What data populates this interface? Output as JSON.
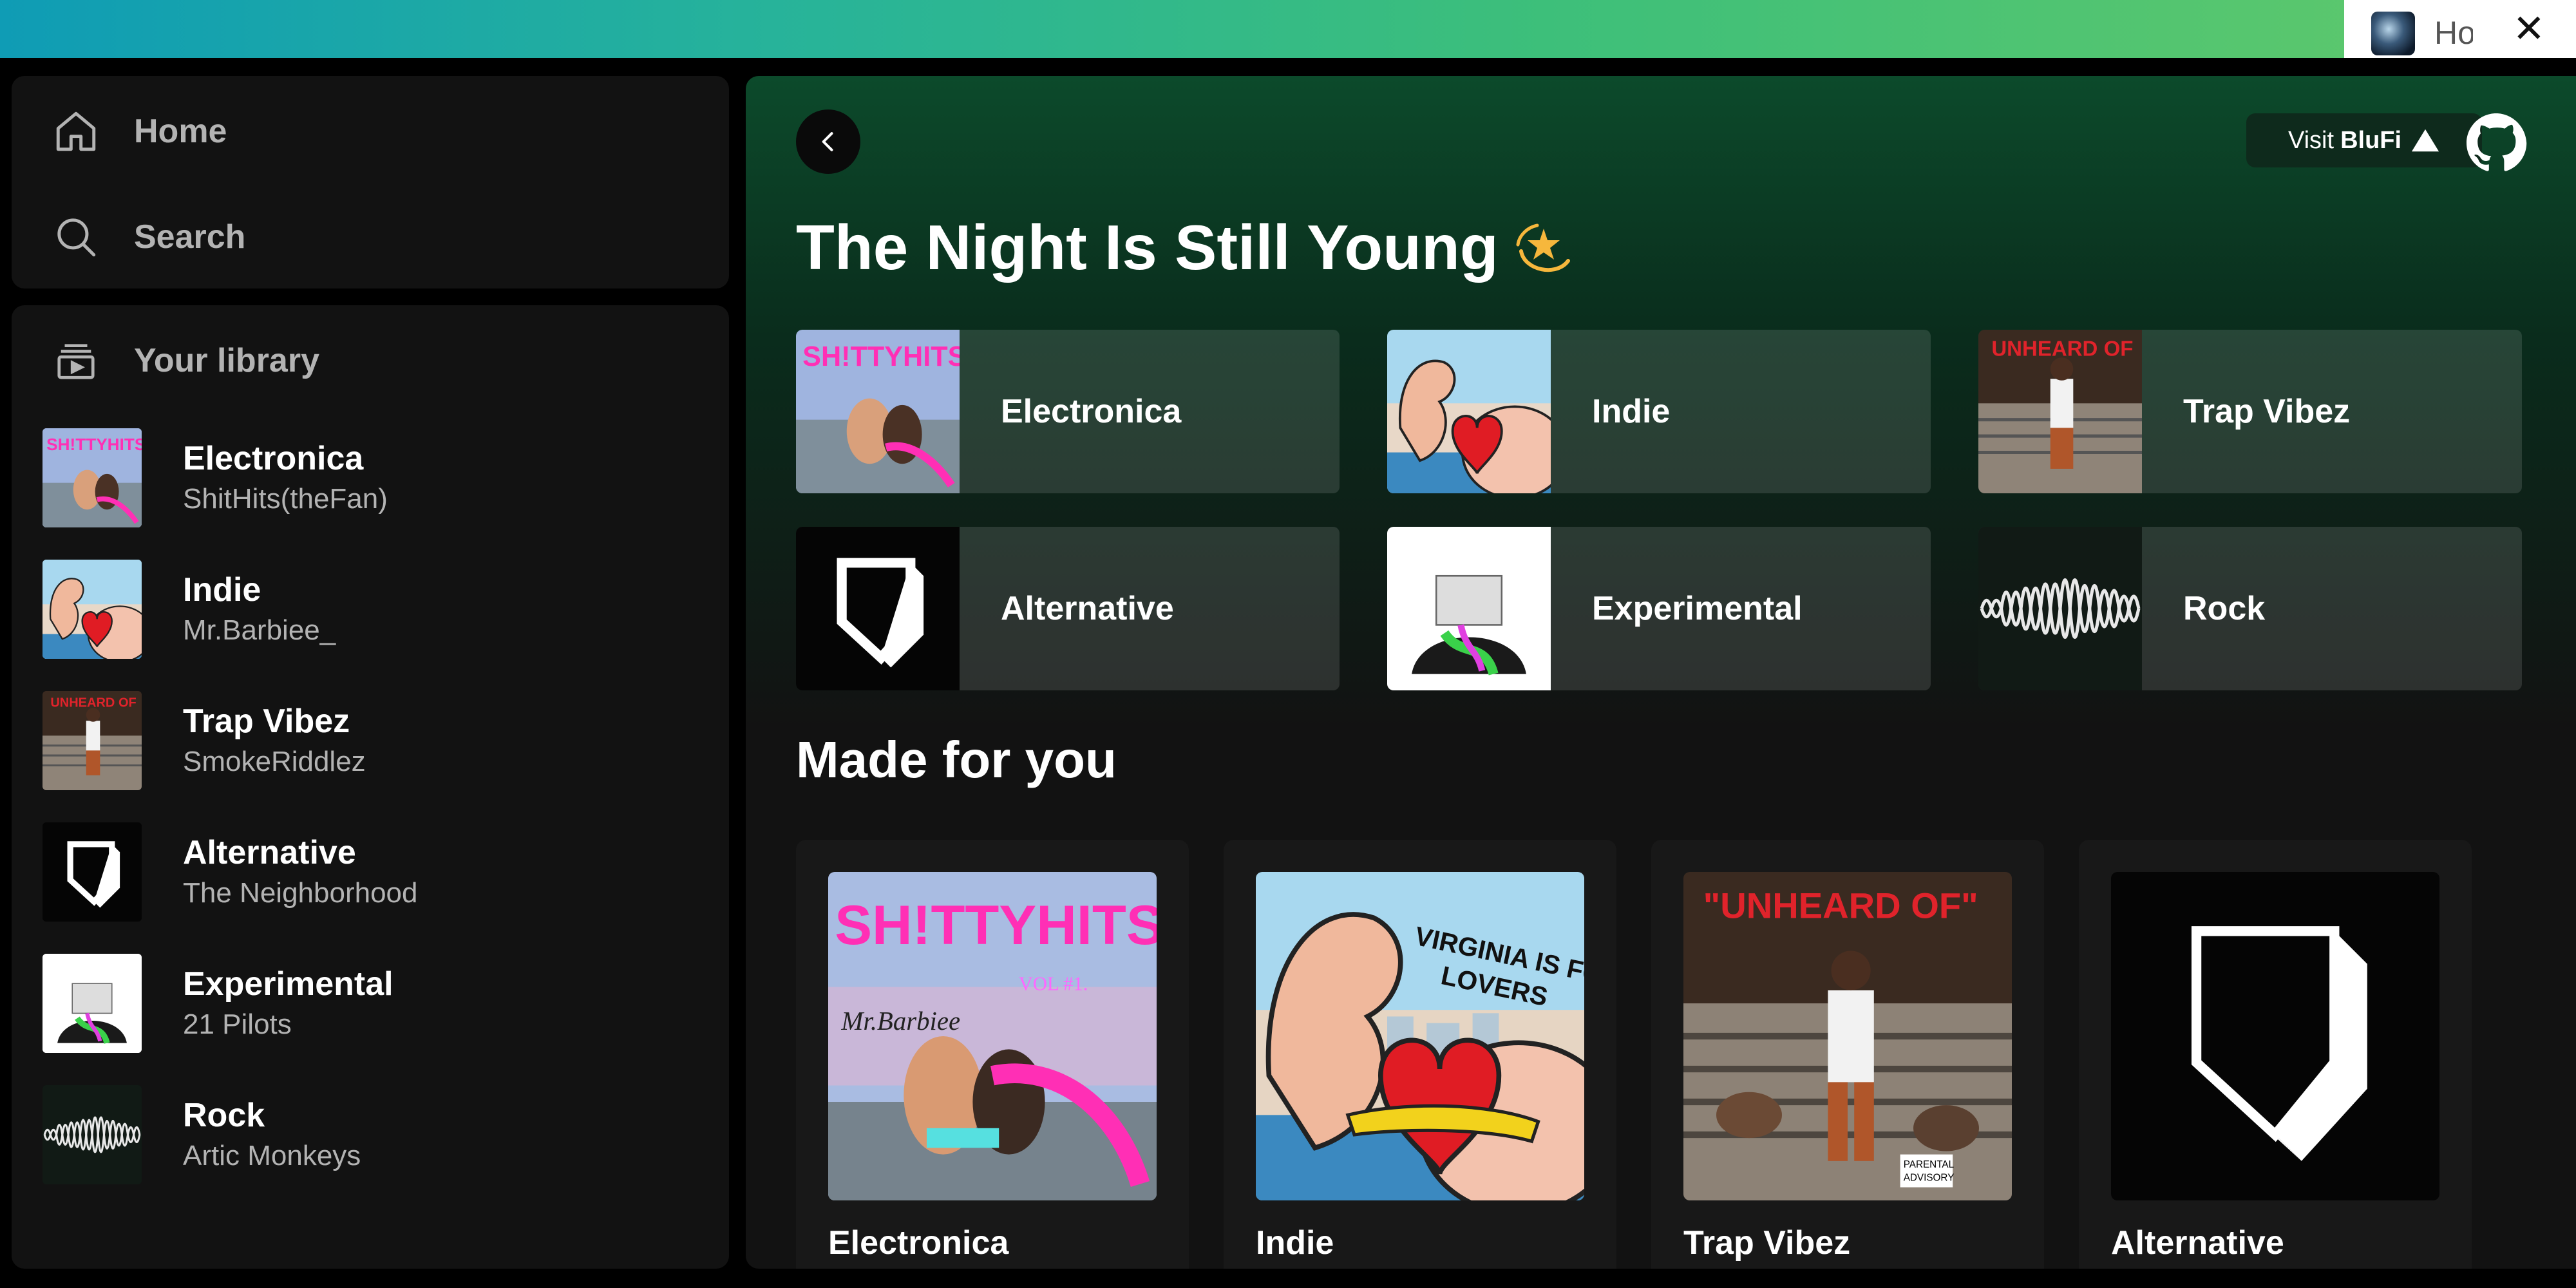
{
  "browser_tab": {
    "title": "Ho",
    "close_glyph": "✕",
    "icon": "avatar-icon"
  },
  "nav": {
    "home": {
      "label": "Home",
      "icon": "home-icon"
    },
    "search": {
      "label": "Search",
      "icon": "search-icon"
    }
  },
  "library": {
    "title": "Your library",
    "icon": "library-icon",
    "items": [
      {
        "title": "Electronica",
        "artist": "ShitHits(theFan)"
      },
      {
        "title": "Indie",
        "artist": "Mr.Barbiee_"
      },
      {
        "title": "Trap Vibez",
        "artist": "SmokeRiddlez"
      },
      {
        "title": "Alternative",
        "artist": "The Neighborhood"
      },
      {
        "title": "Experimental",
        "artist": "21 Pilots"
      },
      {
        "title": "Rock",
        "artist": "Artic Monkeys"
      }
    ]
  },
  "header": {
    "back_icon": "chevron-left-icon",
    "visit_prefix": "Visit",
    "visit_brand": "BluFi",
    "github_icon": "github-icon"
  },
  "greeting": {
    "text": "The Night Is Still Young",
    "emoji": "dizzy-star-icon"
  },
  "quick_picks": [
    "Electronica",
    "Indie",
    "Trap Vibez",
    "Alternative",
    "Experimental",
    "Rock"
  ],
  "made_for_you": {
    "heading": "Made for you",
    "cards": [
      "Electronica",
      "Indie",
      "Trap Vibez",
      "Alternative"
    ]
  },
  "artwork_text": {
    "electronica": "SH!TTYHITS",
    "indie": "VIRGINIA IS FOR LOVERS",
    "trap": "\"UNHEARD OF\""
  },
  "colors": {
    "accent_green": "#1ed760",
    "main_gradient_top": "#0c4a2b",
    "panel": "#121212",
    "card": "#181818"
  }
}
